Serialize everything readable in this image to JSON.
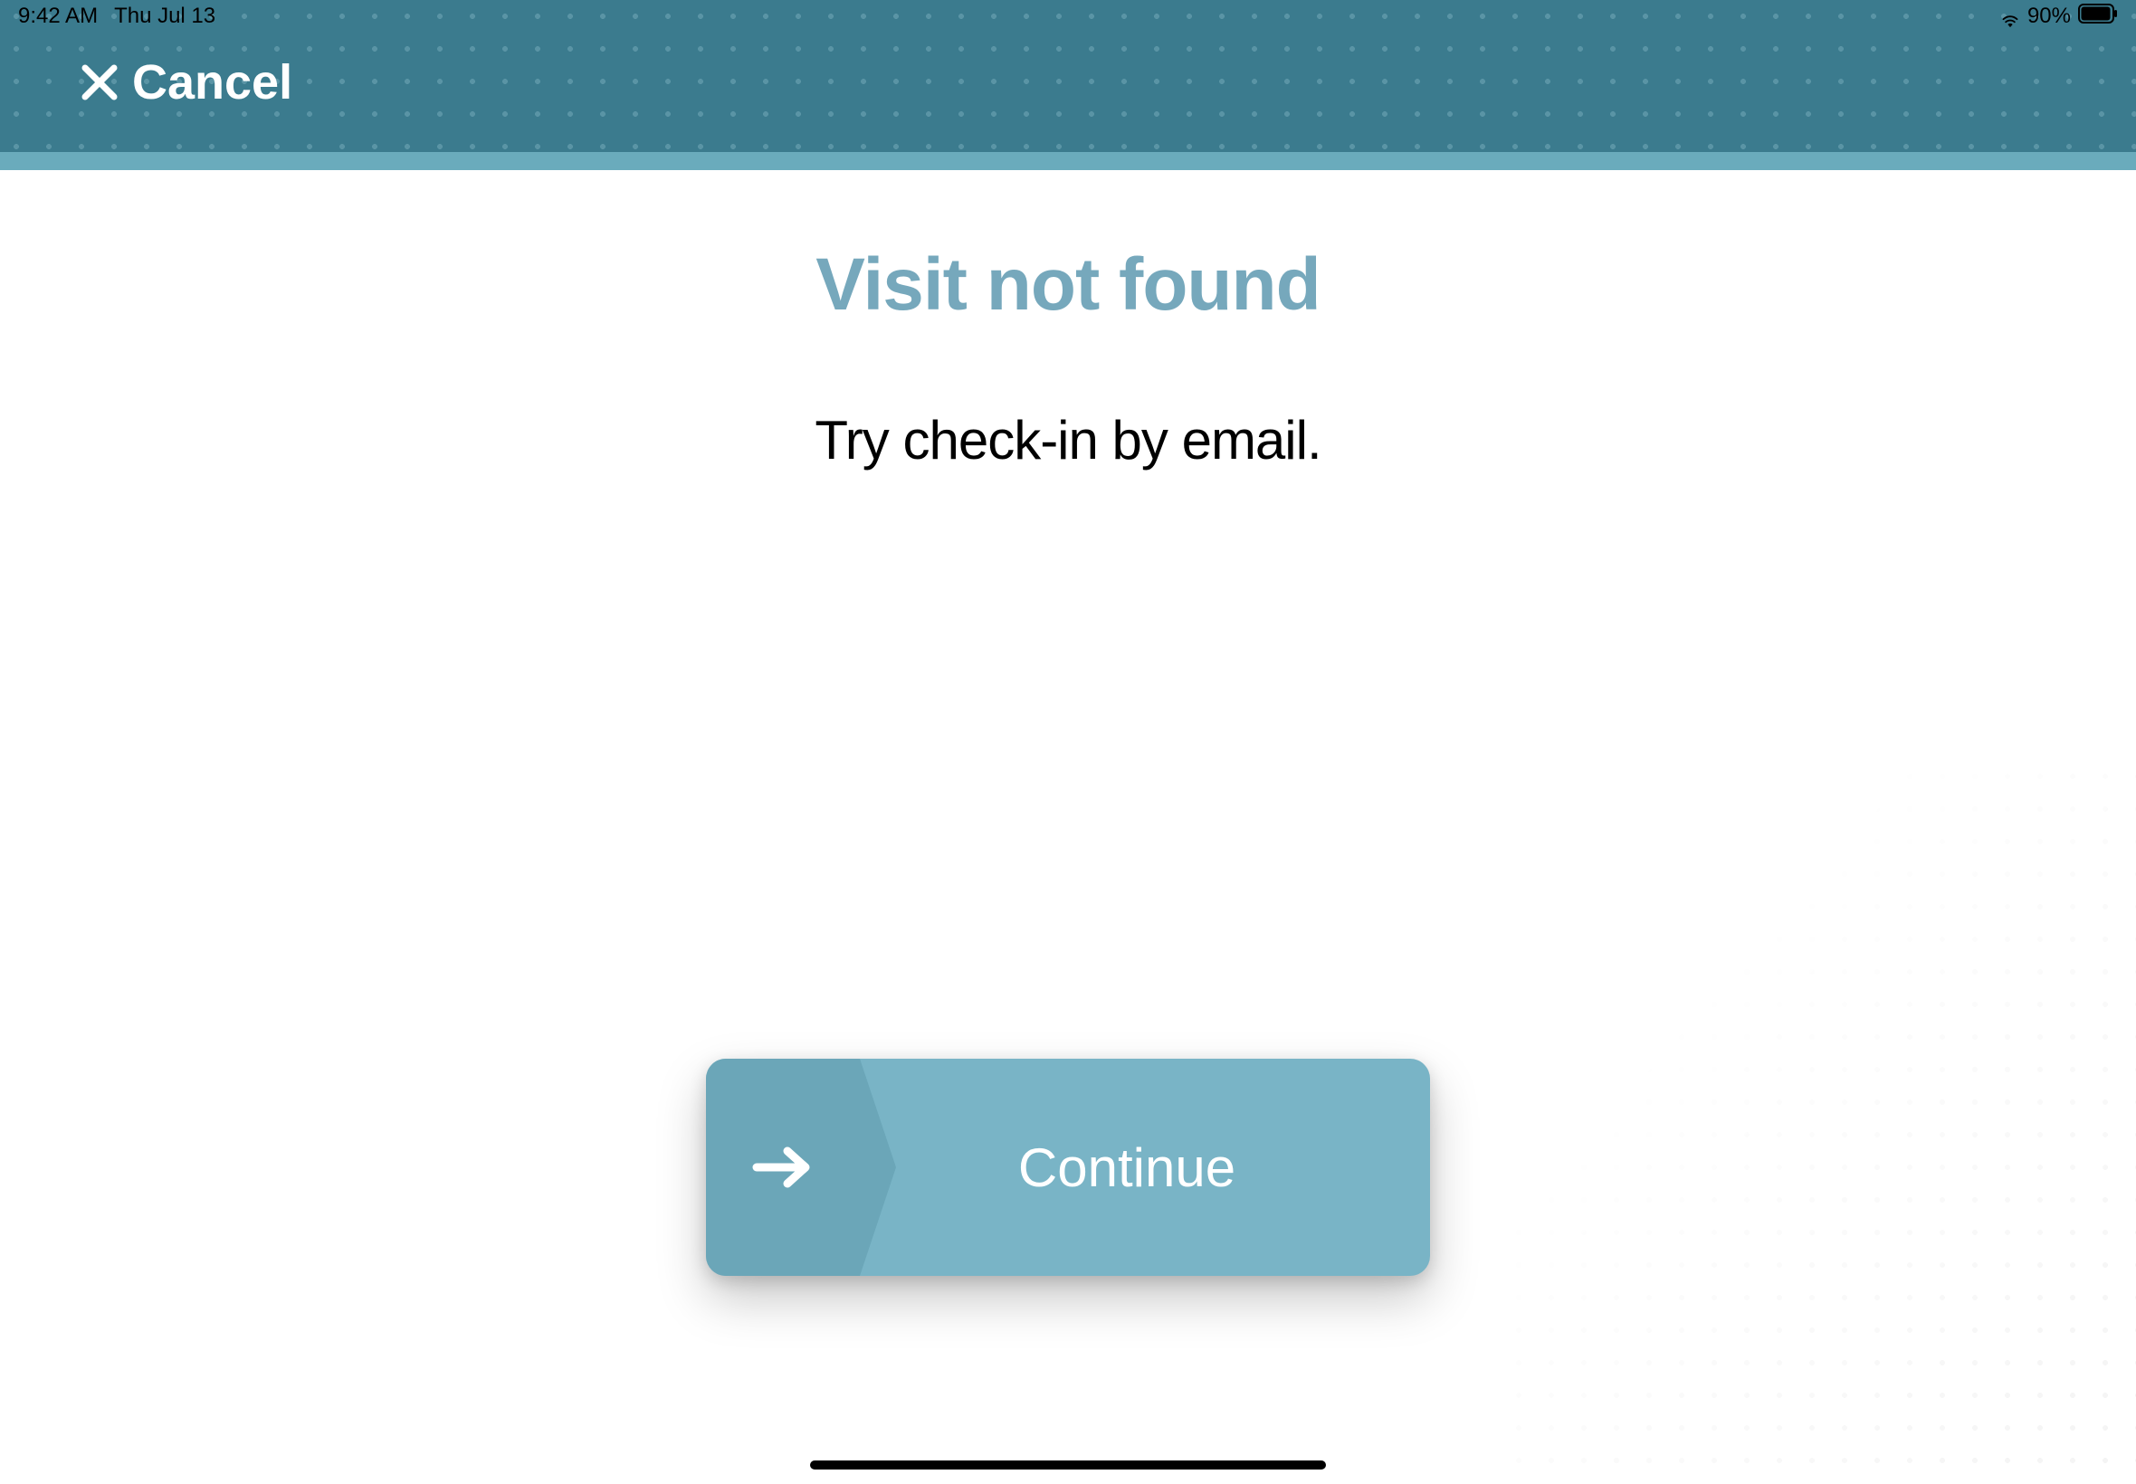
{
  "status_bar": {
    "time": "9:42 AM",
    "date": "Thu Jul 13",
    "battery_percent": "90%"
  },
  "header": {
    "cancel_label": "Cancel"
  },
  "main": {
    "title": "Visit not found",
    "subtitle": "Try check-in by email.",
    "continue_label": "Continue"
  }
}
